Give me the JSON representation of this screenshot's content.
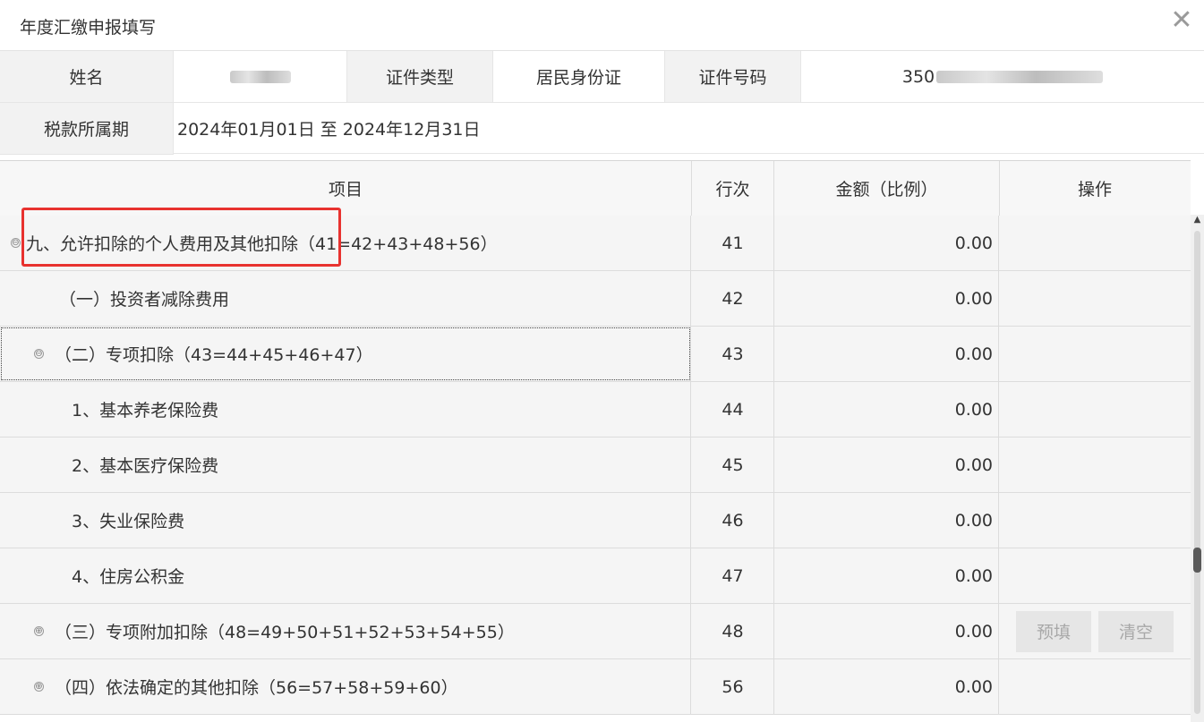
{
  "window": {
    "title": "年度汇缴申报填写",
    "close_glyph": "✕"
  },
  "info": {
    "name_label": "姓名",
    "id_type_label": "证件类型",
    "id_type_value": "居民身份证",
    "id_no_label": "证件号码",
    "id_no_prefix": "350",
    "period_label": "税款所属期",
    "period_value": "2024年01月01日 至 2024年12月31日"
  },
  "table": {
    "headers": {
      "item": "项目",
      "line": "行次",
      "amount": "金额（比例）",
      "op": "操作"
    },
    "rows": [
      {
        "label": "九、允许扣除的个人费用及其他扣除（41=42+43+48+56）",
        "line": "41",
        "amount": "0.00",
        "toggle": "⊖"
      },
      {
        "label": "（一）投资者减除费用",
        "line": "42",
        "amount": "0.00"
      },
      {
        "label": "（二）专项扣除（43=44+45+46+47）",
        "line": "43",
        "amount": "0.00",
        "toggle": "⊖"
      },
      {
        "label": "1、基本养老保险费",
        "line": "44",
        "amount": "0.00"
      },
      {
        "label": "2、基本医疗保险费",
        "line": "45",
        "amount": "0.00"
      },
      {
        "label": "3、失业保险费",
        "line": "46",
        "amount": "0.00"
      },
      {
        "label": "4、住房公积金",
        "line": "47",
        "amount": "0.00"
      },
      {
        "label": "（三）专项附加扣除（48=49+50+51+52+53+54+55）",
        "line": "48",
        "amount": "0.00",
        "toggle": "⊕"
      },
      {
        "label": "（四）依法确定的其他扣除（56=57+58+59+60）",
        "line": "56",
        "amount": "0.00",
        "toggle": "⊕"
      }
    ],
    "buttons": {
      "prefill": "预填",
      "clear": "清空"
    }
  },
  "colors": {
    "highlight": "#e8322f",
    "label_bg": "#f2f2f2",
    "row_bg": "#f5f5f5"
  }
}
